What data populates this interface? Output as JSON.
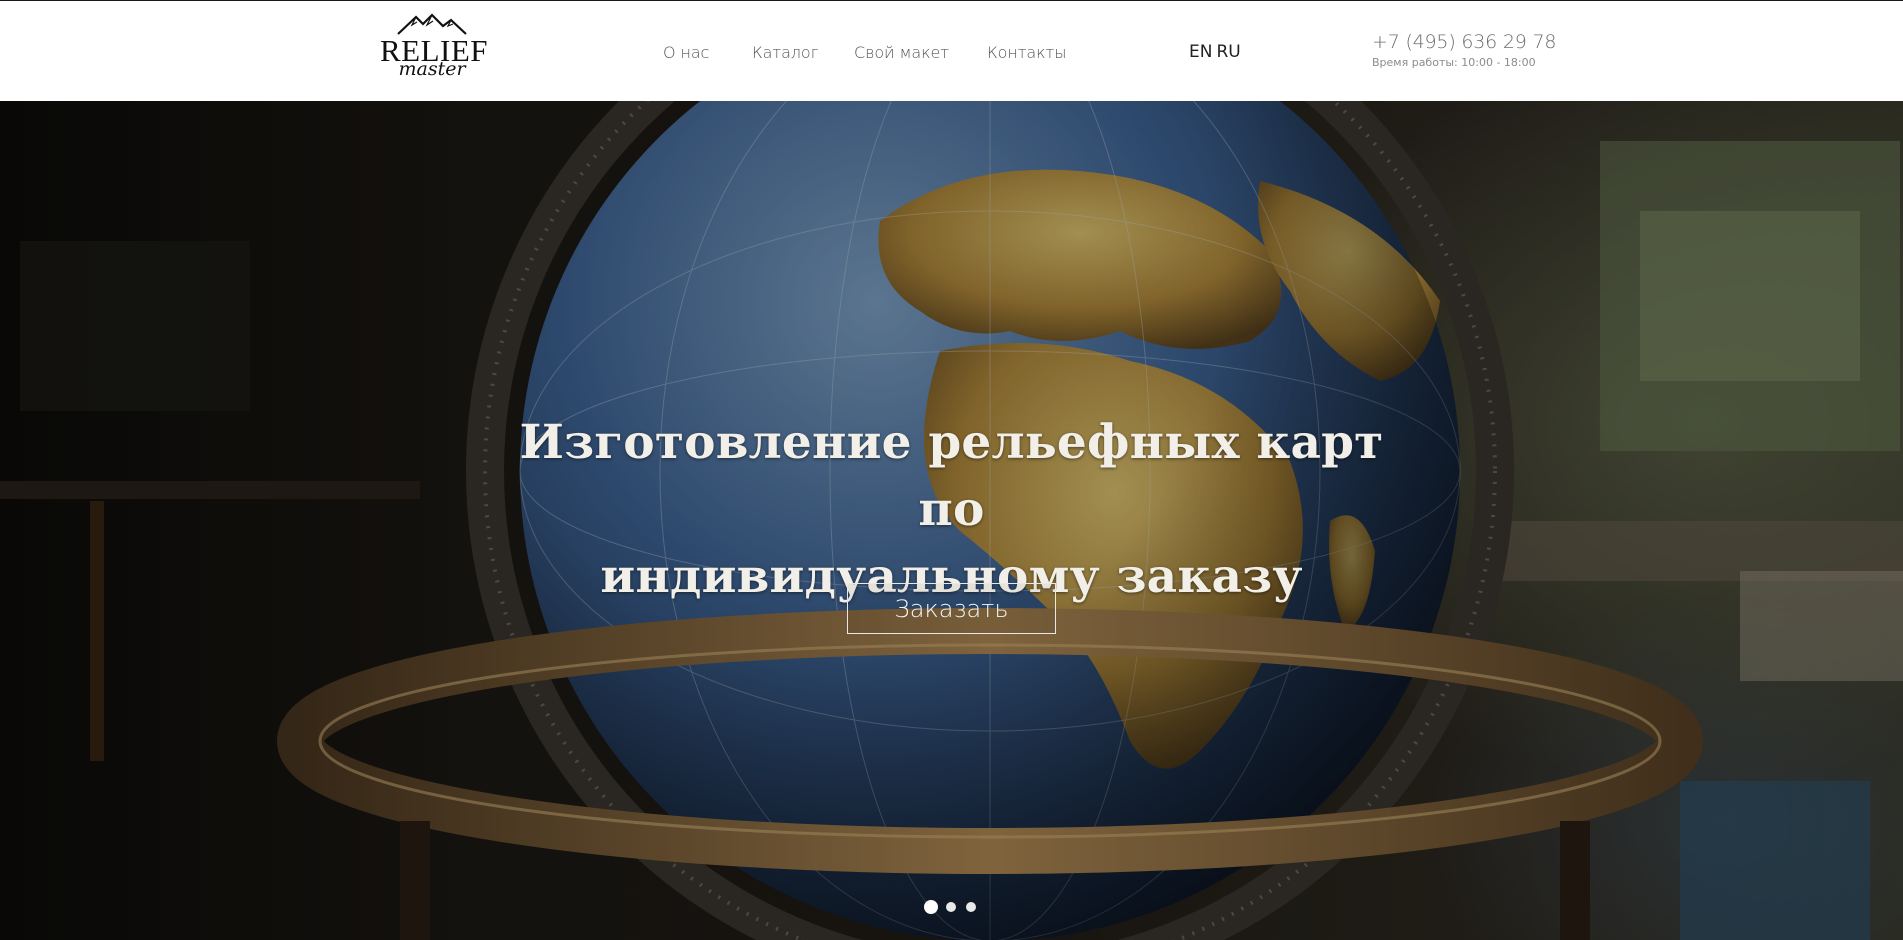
{
  "header": {
    "logo": {
      "word": "RELIEF",
      "script": "master"
    },
    "nav": [
      {
        "label": "О нас"
      },
      {
        "label": "Каталог"
      },
      {
        "label": "Свой макет"
      },
      {
        "label": "Контакты"
      }
    ],
    "languages": [
      "EN",
      "RU"
    ],
    "phone": "+7 (495) 636 29 78",
    "hours": "Время работы: 10:00 - 18:00"
  },
  "hero": {
    "title_line1": "Изготовление рельефных карт по",
    "title_line2": "индивидуальному заказу",
    "cta_label": "Заказать",
    "slides_count": 3,
    "active_slide": 1
  },
  "colors": {
    "header_bg": "#ffffff",
    "nav_text": "#575757",
    "hero_text": "#f2efe8",
    "ocean": "#3b5b8a",
    "land": "#b8963f"
  }
}
